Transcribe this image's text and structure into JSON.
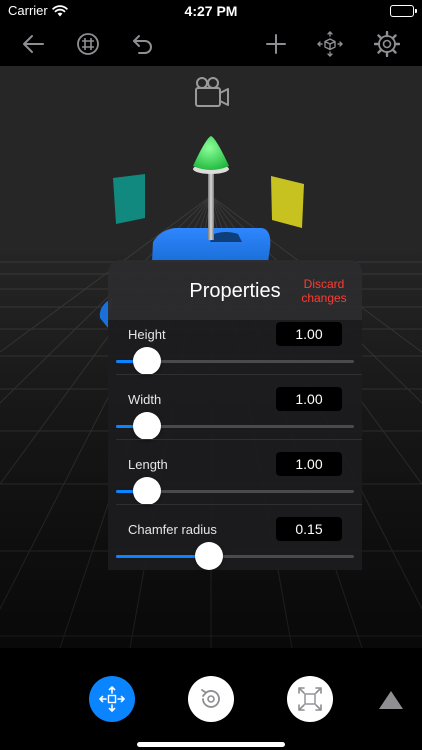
{
  "status_bar": {
    "carrier": "Carrier",
    "time": "4:27 PM"
  },
  "toolbar": {
    "items": [
      {
        "icon": "arrow-left-icon"
      },
      {
        "icon": "grid-icon"
      },
      {
        "icon": "undo-icon"
      },
      {
        "icon": "plus-icon"
      },
      {
        "icon": "cube-arrows-icon"
      },
      {
        "icon": "gear-icon"
      }
    ],
    "color": "#8e8e93"
  },
  "properties": {
    "title": "Properties",
    "discard_label": "Discard changes",
    "items": [
      {
        "label": "Height",
        "value": "1.00",
        "slider": 0.13
      },
      {
        "label": "Width",
        "value": "1.00",
        "slider": 0.13
      },
      {
        "label": "Length",
        "value": "1.00",
        "slider": 0.13
      },
      {
        "label": "Chamfer radius",
        "value": "0.15",
        "slider": 0.39
      }
    ]
  },
  "bottom_bar": {
    "buttons": [
      {
        "icon": "move-arrows-icon",
        "active": true
      },
      {
        "icon": "rotate-icon",
        "active": false
      },
      {
        "icon": "scale-icon",
        "active": false
      }
    ],
    "extra_icon": "triangle-icon"
  },
  "colors": {
    "accent": "#0a84ff",
    "discard": "#ff3b30",
    "gizmo_green": "#30d158",
    "plane_teal": "#12897f",
    "plane_yellow": "#c8c220",
    "object_blue": "#1a6fd8"
  }
}
